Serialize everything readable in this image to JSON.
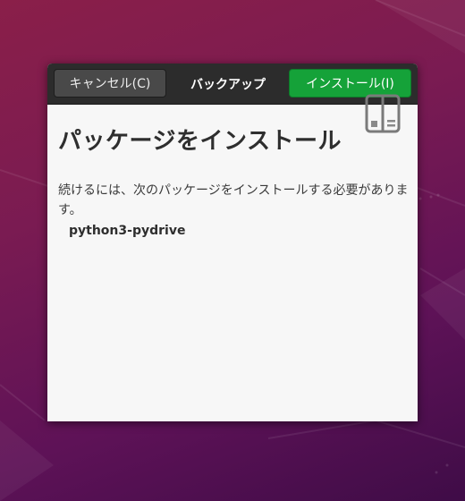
{
  "dialog": {
    "header": {
      "cancel_label": "キャンセル(C)",
      "title": "バックアップ",
      "install_label": "インストール(I)"
    },
    "page_title": "パッケージをインストール",
    "description": "続けるには、次のパッケージをインストールする必要があります。",
    "packages": [
      "python3-pydrive"
    ],
    "icon": "package-install-icon"
  },
  "colors": {
    "install_accent": "#15a239",
    "headerbar": "#2c2c2c",
    "dialog_bg": "#f7f7f7"
  }
}
